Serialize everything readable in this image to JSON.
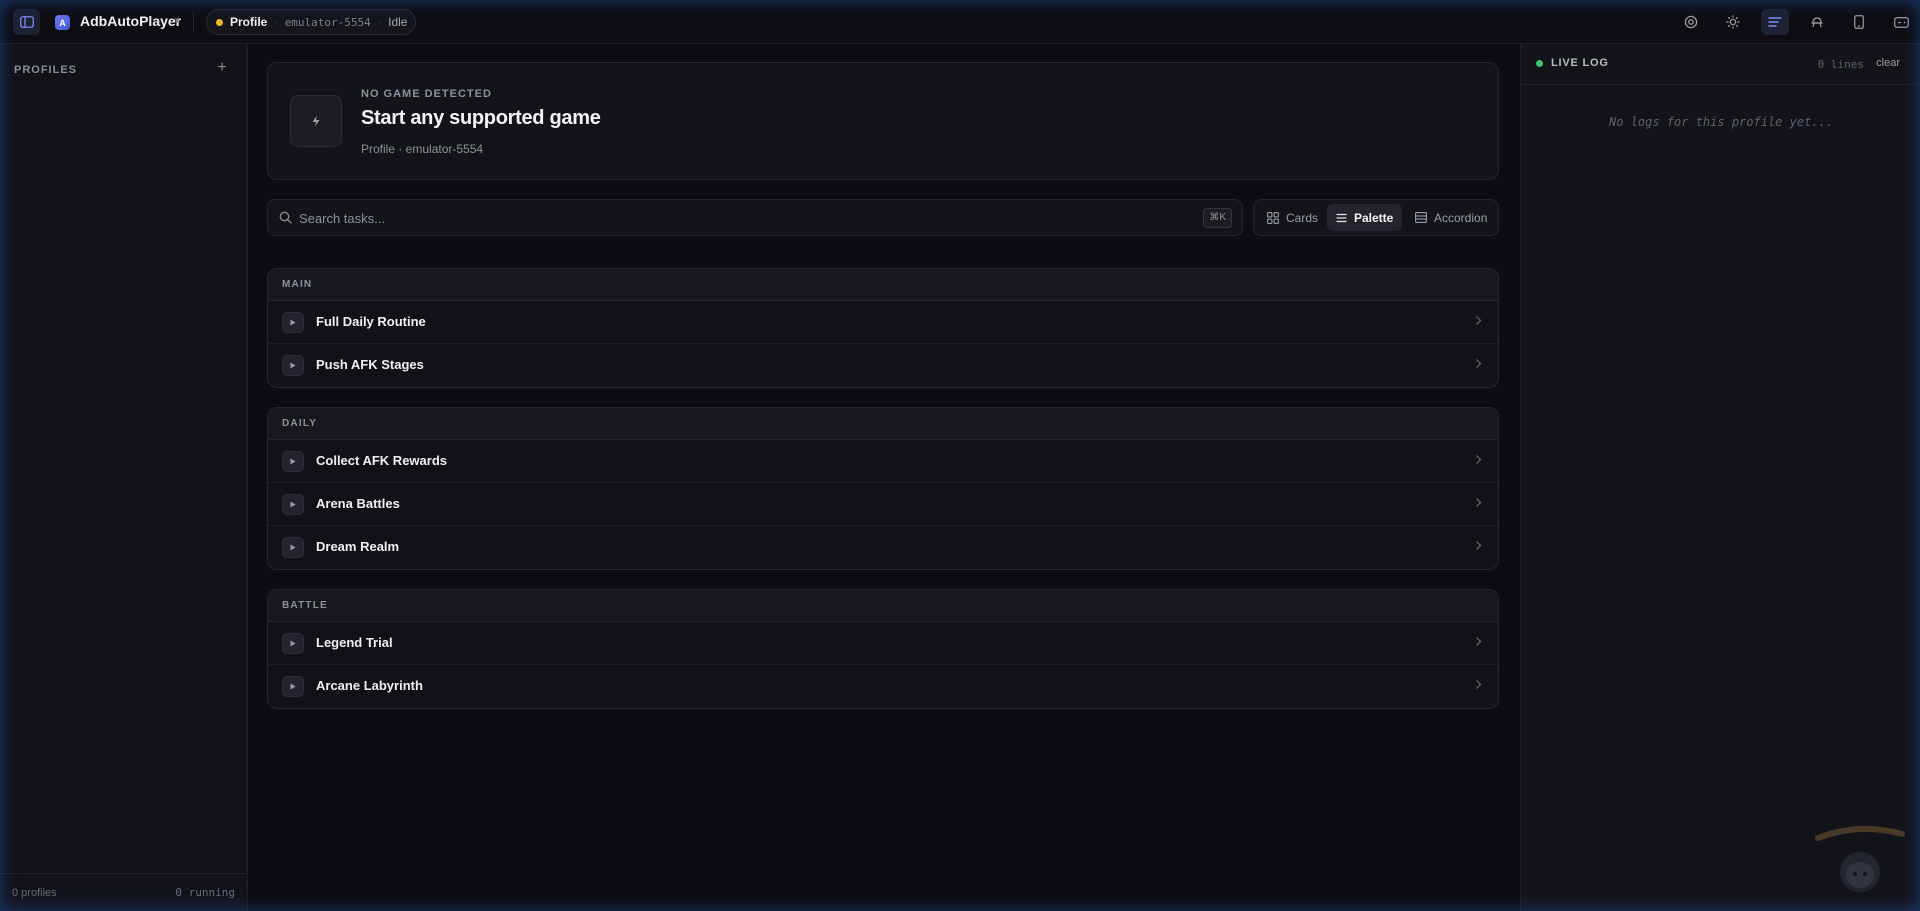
{
  "app": {
    "name": "AdbAutoPlayer",
    "logo_letter": "A"
  },
  "topbar": {
    "profile_name": "Profile",
    "device": "emulator-5554",
    "state": "Idle",
    "separator": "·",
    "icons": [
      "target-icon",
      "sun-icon",
      "log-panel-icon",
      "bot-icon",
      "phone-icon",
      "gamepad-icon",
      "gear-icon"
    ]
  },
  "sidebar": {
    "title": "PROFILES",
    "add_symbol": "+",
    "footer_profiles": "0 profiles",
    "footer_running": "0 running"
  },
  "hero": {
    "eyebrow": "NO GAME DETECTED",
    "title": "Start any supported game",
    "subtitle": "Profile · emulator-5554"
  },
  "search": {
    "placeholder": "Search tasks...",
    "shortcut": "⌘K"
  },
  "view_modes": [
    {
      "label": "Cards",
      "active": false
    },
    {
      "label": "Palette",
      "active": true
    },
    {
      "label": "Accordion",
      "active": false
    }
  ],
  "groups": [
    {
      "title": "MAIN",
      "tasks": [
        "Full Daily Routine",
        "Push AFK Stages"
      ]
    },
    {
      "title": "DAILY",
      "tasks": [
        "Collect AFK Rewards",
        "Arena Battles",
        "Dream Realm"
      ]
    },
    {
      "title": "BATTLE",
      "tasks": [
        "Legend Trial",
        "Arcane Labyrinth"
      ]
    }
  ],
  "log": {
    "title": "LIVE LOG",
    "lines": "0 lines",
    "clear_label": "clear",
    "empty_message": "No logs for this profile yet..."
  },
  "colors": {
    "accent": "#6d7bf0",
    "status_idle": "#f2b432",
    "live": "#3ec46d"
  }
}
